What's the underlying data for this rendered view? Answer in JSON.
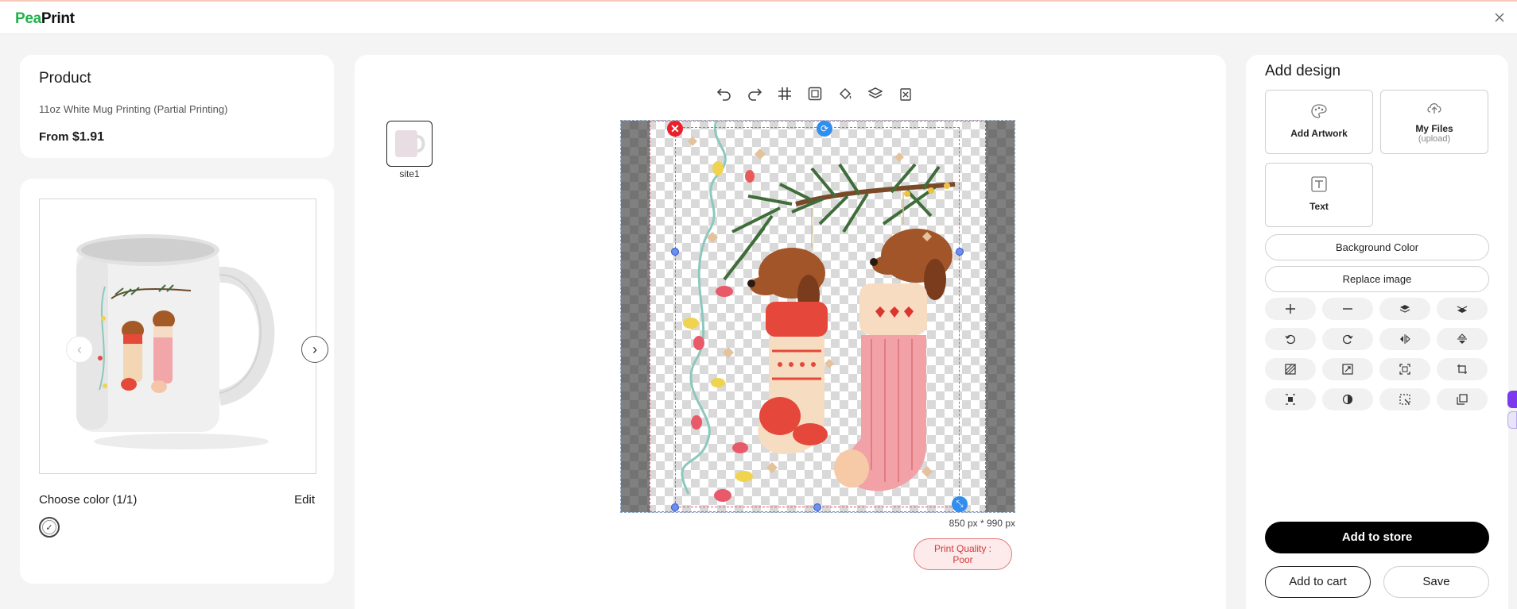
{
  "header": {
    "logo_pea": "Pea",
    "logo_print": "Print"
  },
  "product": {
    "title": "Product",
    "name": "11oz White Mug Printing (Partial Printing)",
    "price_prefix": "From",
    "price": "$1.91"
  },
  "preview": {
    "choose_color": "Choose color  (1/1)",
    "edit": "Edit",
    "prev_glyph": "‹",
    "next_glyph": "›",
    "swatch_check": "✓"
  },
  "editor": {
    "thumb_label": "site1",
    "dimensions": "850 px * 990 px",
    "quality_line1": "Print Quality :",
    "quality_line2": "Poor",
    "delete_glyph": "✕",
    "rotate_glyph": "⟳",
    "scale_glyph": "⤡",
    "toolbar_icons": [
      "undo-icon",
      "redo-icon",
      "grid-icon",
      "fit-icon",
      "fill-icon",
      "layers-icon",
      "clear-icon"
    ]
  },
  "design": {
    "title": "Add design",
    "tiles": [
      {
        "label": "Add Artwork",
        "sub": ""
      },
      {
        "label": "My Files",
        "sub": "(upload)"
      },
      {
        "label": "Text",
        "sub": ""
      }
    ],
    "background_color": "Background Color",
    "replace_image": "Replace image",
    "icon_buttons": [
      "plus-icon",
      "minus-icon",
      "layer-up-icon",
      "layer-down-icon",
      "rotate-left-icon",
      "rotate-right-icon",
      "flip-horizontal-icon",
      "flip-vertical-icon",
      "pattern-icon",
      "expand-icon",
      "fit-frame-icon",
      "crop-icon",
      "align-center-icon",
      "contrast-icon",
      "select-area-icon",
      "duplicate-icon"
    ],
    "add_to_store": "Add to store",
    "add_to_cart": "Add to cart",
    "save": "Save"
  },
  "colors": {
    "brand_green": "#21b24b",
    "primary_black": "#000000",
    "quality_red": "#d23a3a",
    "handle_blue": "#2f8ef0",
    "delete_red": "#e8202a"
  }
}
